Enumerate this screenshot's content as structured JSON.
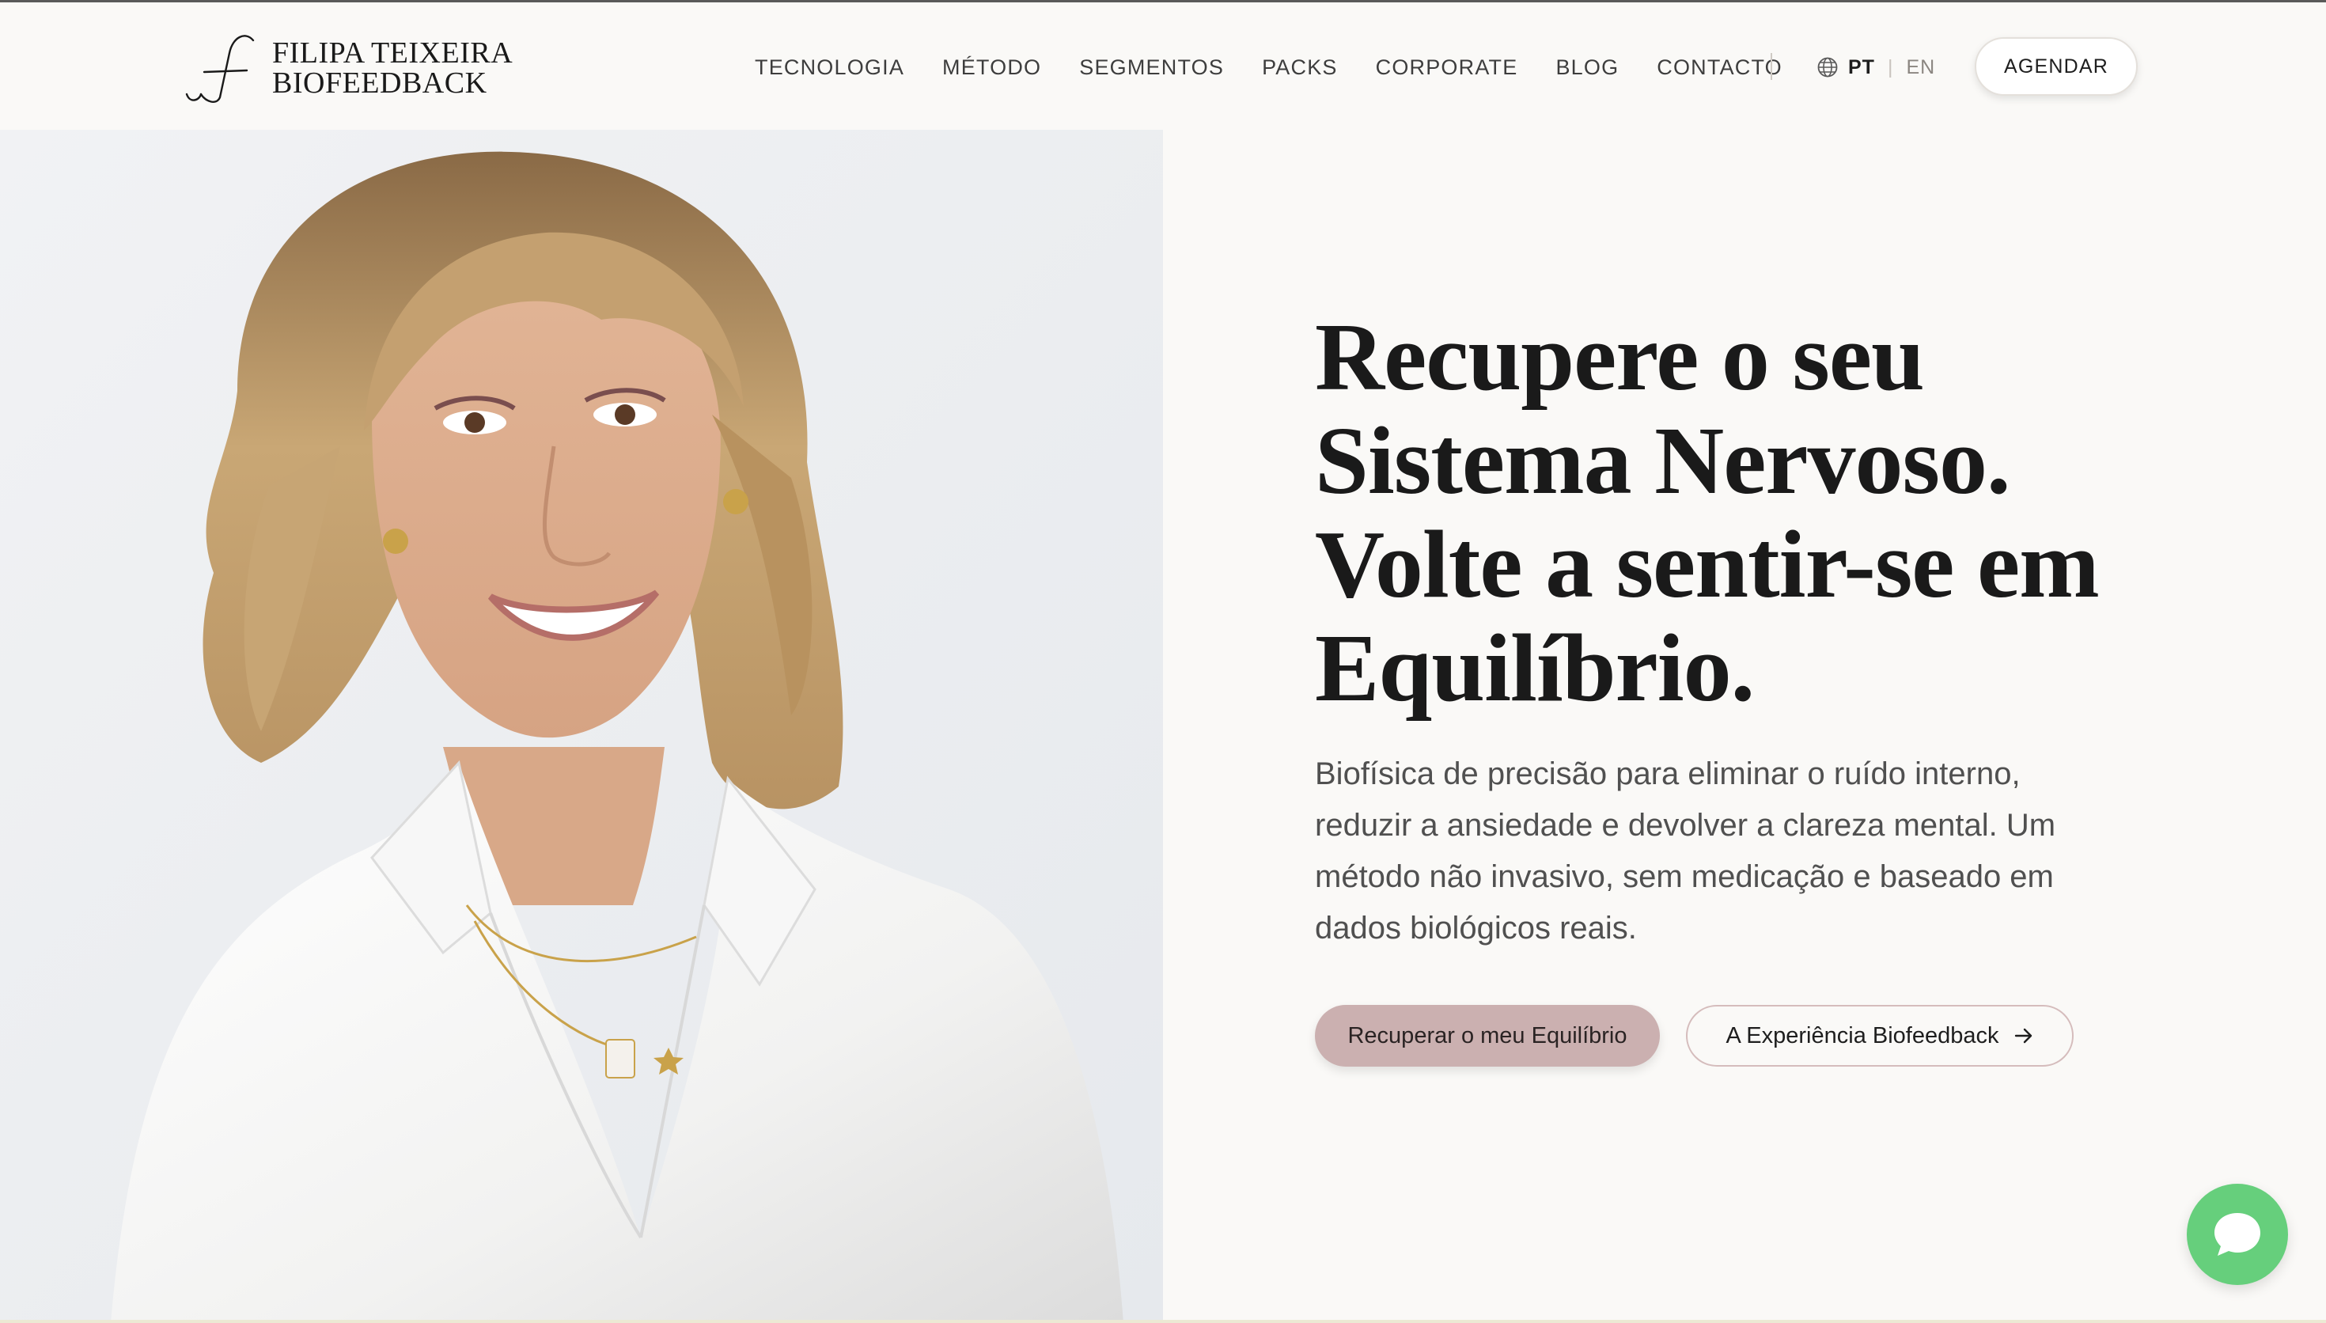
{
  "brand": {
    "name_line1": "FILIPA TEIXEIRA",
    "name_line2": "BIOFEEDBACK",
    "logo_icon": "script-f-icon"
  },
  "nav": {
    "items": [
      {
        "label": "TECNOLOGIA"
      },
      {
        "label": "MÉTODO"
      },
      {
        "label": "SEGMENTOS"
      },
      {
        "label": "PACKS"
      },
      {
        "label": "CORPORATE"
      },
      {
        "label": "BLOG"
      },
      {
        "label": "CONTACTO"
      }
    ],
    "language": {
      "icon": "globe-icon",
      "active": "PT",
      "other": "EN",
      "separator": "|"
    },
    "cta_label": "AGENDAR"
  },
  "hero": {
    "photo": "portrait-photo",
    "headline": [
      "Recupere o seu",
      "Sistema Nervoso.",
      "Volte a sentir-se em",
      "Equilíbrio."
    ],
    "subtext": "Biofísica de precisão para eliminar o ruído interno, reduzir a ansiedade e devolver a clareza mental. Um método não invasivo, sem medicação e baseado em dados biológicos reais.",
    "primary_cta": "Recuperar o meu Equilíbrio",
    "secondary_cta": "A Experiência Biofeedback",
    "secondary_cta_icon": "arrow-right-icon"
  },
  "chat": {
    "icon": "chat-bubble-icon"
  },
  "colors": {
    "background": "#faf9f7",
    "primary_cta": "#cbb0b0",
    "secondary_cta_border": "#d5bcbc",
    "chat": "#66cf7c",
    "headline": "#1a1a1a",
    "body_text": "#505050"
  }
}
